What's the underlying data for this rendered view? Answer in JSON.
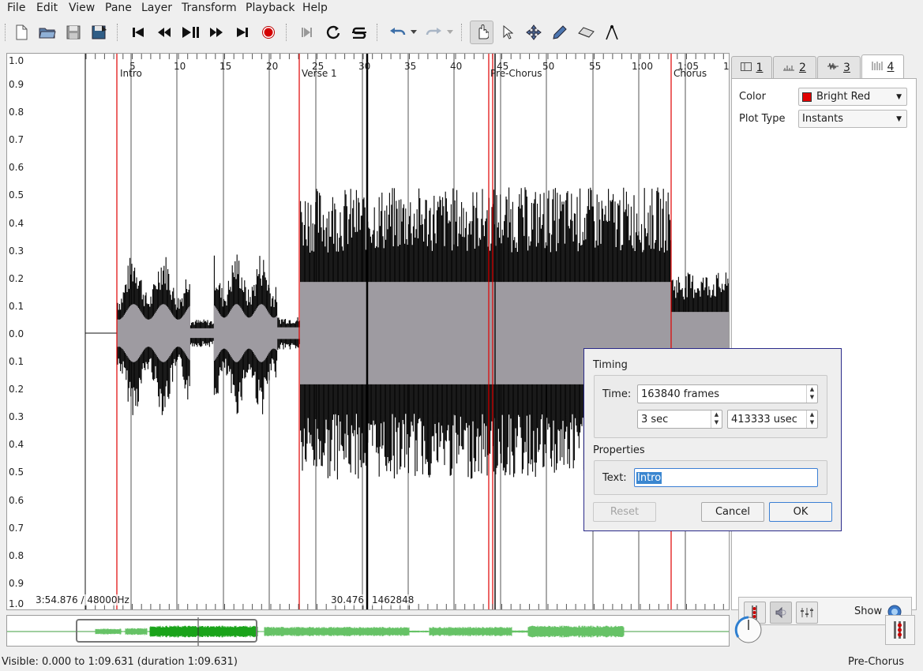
{
  "menu": [
    "File",
    "Edit",
    "View",
    "Pane",
    "Layer",
    "Transform",
    "Playback",
    "Help"
  ],
  "toolbar": {
    "icons": [
      "new-file-icon",
      "open-folder-icon",
      "save-icon",
      "save-as-icon",
      "rewind-start-icon",
      "rewind-icon",
      "play-pause-icon",
      "fast-forward-icon",
      "skip-end-icon",
      "record-icon",
      "constrain-playback-icon",
      "loop-icon",
      "solo-icon",
      "undo-icon",
      "redo-icon",
      "navigate-hand-icon",
      "select-arrow-icon",
      "move-icon",
      "draw-pencil-icon",
      "erase-icon",
      "measure-icon"
    ]
  },
  "scale": {
    "labels": [
      "1.0",
      "0.9",
      "0.8",
      "0.7",
      "0.6",
      "0.5",
      "0.4",
      "0.3",
      "0.2",
      "0.1",
      "0.0",
      "0.1",
      "0.2",
      "0.3",
      "0.4",
      "0.5",
      "0.6",
      "0.7",
      "0.8",
      "0.9",
      "1.0"
    ]
  },
  "ruler": {
    "ticks": [
      "5",
      "10",
      "15",
      "20",
      "25",
      "30",
      "35",
      "40",
      "45",
      "50",
      "55",
      "1:00",
      "1:05",
      "1"
    ]
  },
  "instants": [
    {
      "label": "Intro"
    },
    {
      "label": "Verse 1"
    },
    {
      "label": "Pre-Chorus"
    },
    {
      "label": "Chorus"
    }
  ],
  "pane_status": {
    "left": "3:54.876 / 48000Hz",
    "center": "30.476",
    "center_frames": "1462848"
  },
  "tabs": [
    {
      "label": "1",
      "icon": "pane-layout-icon"
    },
    {
      "label": "2",
      "icon": "time-ruler-icon"
    },
    {
      "label": "3",
      "icon": "waveform-icon"
    },
    {
      "label": "4",
      "icon": "instants-icon",
      "active": true
    }
  ],
  "properties": {
    "color_label": "Color",
    "color_value": "Bright Red",
    "color_hex": "#e00000",
    "plot_type_label": "Plot Type",
    "plot_type_value": "Instants"
  },
  "layer_bar": {
    "show_label": "Show"
  },
  "statusbar": {
    "visible": "Visible: 0.000 to 1:09.631 (duration 1:09.631)",
    "current_instant": "Pre-Chorus"
  },
  "dialog": {
    "timing_title": "Timing",
    "time_label": "Time:",
    "frames_value": "163840 frames",
    "sec_value": "3 sec",
    "usec_value": "413333 usec",
    "properties_title": "Properties",
    "text_label": "Text:",
    "text_value": "Intro",
    "reset_label": "Reset",
    "cancel_label": "Cancel",
    "ok_label": "OK"
  }
}
